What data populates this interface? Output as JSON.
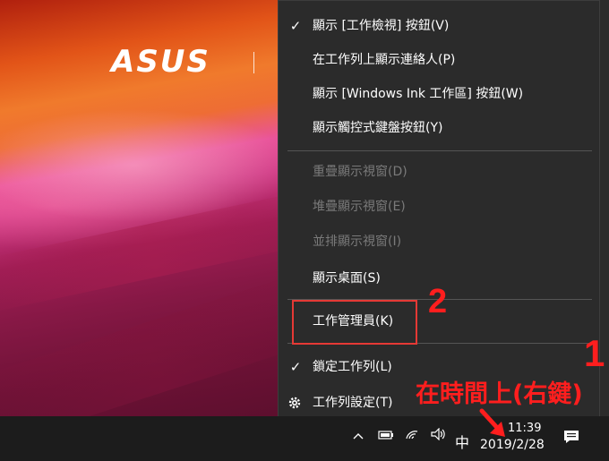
{
  "wallpaper": {
    "brand": "ASUS"
  },
  "menu": {
    "items": [
      {
        "label": "顯示 [工作檢視] 按鈕(V)",
        "checked": true,
        "enabled": true
      },
      {
        "label": "在工作列上顯示連絡人(P)",
        "checked": false,
        "enabled": true
      },
      {
        "label": "顯示 [Windows Ink 工作區] 按鈕(W)",
        "checked": false,
        "enabled": true
      },
      {
        "label": "顯示觸控式鍵盤按鈕(Y)",
        "checked": false,
        "enabled": true
      },
      {
        "label": "重疊顯示視窗(D)",
        "checked": false,
        "enabled": false
      },
      {
        "label": "堆疊顯示視窗(E)",
        "checked": false,
        "enabled": false
      },
      {
        "label": "並排顯示視窗(I)",
        "checked": false,
        "enabled": false
      },
      {
        "label": "顯示桌面(S)",
        "checked": false,
        "enabled": true
      },
      {
        "label": "工作管理員(K)",
        "checked": false,
        "enabled": true
      },
      {
        "label": "鎖定工作列(L)",
        "checked": true,
        "enabled": true
      },
      {
        "label": "工作列設定(T)",
        "checked": false,
        "enabled": true,
        "icon": "gear-icon"
      }
    ]
  },
  "annotations": {
    "step2": "2",
    "step1": "1",
    "instruction": "在時間上(右鍵)",
    "color": "#ff1e1e"
  },
  "taskbar": {
    "ime": "中",
    "time": "11:39",
    "date": "2019/2/28",
    "tray_icons": [
      "chevron-up-icon",
      "battery-icon",
      "wifi-icon",
      "speaker-icon",
      "notification-icon"
    ]
  }
}
